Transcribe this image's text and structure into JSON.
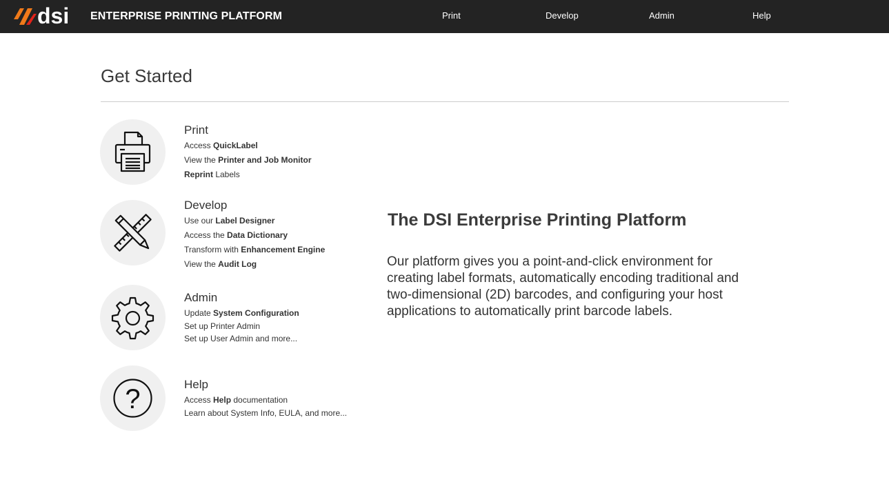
{
  "header": {
    "logo_text": "dsi",
    "app_title": "ENTERPRISE PRINTING PLATFORM",
    "nav": [
      "Print",
      "Develop",
      "Admin",
      "Help"
    ]
  },
  "page": {
    "title": "Get Started"
  },
  "sections": {
    "print": {
      "title": "Print",
      "lines": [
        {
          "pre": "Access ",
          "bold": "QuickLabel",
          "post": ""
        },
        {
          "pre": "View the ",
          "bold": "Printer and Job Monitor",
          "post": ""
        },
        {
          "pre": "",
          "bold": "Reprint",
          "post": " Labels"
        }
      ]
    },
    "develop": {
      "title": "Develop",
      "lines": [
        {
          "pre": "Use our ",
          "bold": "Label Designer",
          "post": ""
        },
        {
          "pre": "Access the ",
          "bold": "Data Dictionary",
          "post": ""
        },
        {
          "pre": "Transform with ",
          "bold": "Enhancement Engine",
          "post": ""
        },
        {
          "pre": "View the ",
          "bold": "Audit Log",
          "post": ""
        }
      ]
    },
    "admin": {
      "title": "Admin",
      "lines": [
        {
          "pre": "Update ",
          "bold": "System Configuration",
          "post": ""
        },
        {
          "pre": "Set up Printer Admin",
          "bold": "",
          "post": ""
        },
        {
          "pre": "Set up User Admin and more...",
          "bold": "",
          "post": ""
        }
      ]
    },
    "help": {
      "title": "Help",
      "lines": [
        {
          "pre": "Access ",
          "bold": "Help",
          "post": " documentation"
        },
        {
          "pre": "Learn about System Info, EULA, and more...",
          "bold": "",
          "post": ""
        }
      ]
    }
  },
  "hero": {
    "title": "The DSI Enterprise Printing Platform",
    "body": "Our platform gives you a point-and-click environment for creating label formats, automatically encoding traditional and two-dimensional (2D) barcodes, and configuring your host applications to automatically print barcode labels."
  },
  "colors": {
    "topbar": "#232323",
    "logo_orange": "#f07a1a",
    "logo_red": "#e2231a",
    "icon_circle": "#f0f0f0"
  },
  "icons": {
    "print": "printer-icon",
    "develop": "ruler-pencil-icon",
    "admin": "gear-icon",
    "help": "question-icon"
  }
}
